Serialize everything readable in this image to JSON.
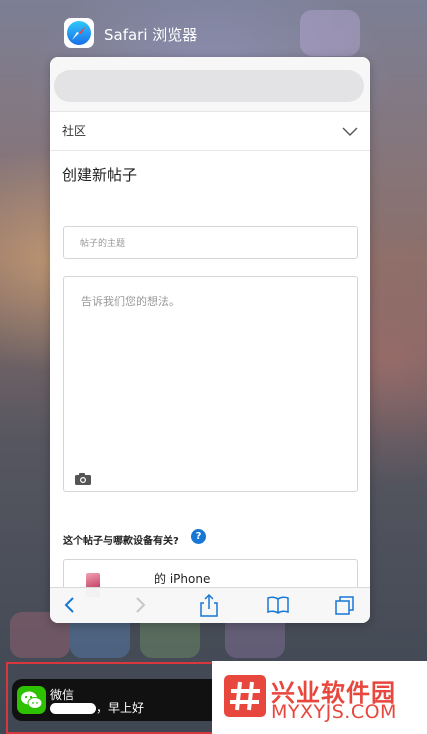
{
  "app_switcher": {
    "app_name": "Safari 浏览器",
    "app_icon": "safari-compass-icon"
  },
  "page": {
    "community_select": "社区",
    "heading": "创建新帖子",
    "subject_placeholder": "帖子的主题",
    "body_placeholder": "告诉我们您的想法。",
    "device_question": "这个帖子与哪款设备有关?",
    "help_icon_glyph": "?",
    "device_name": "的 iPhone"
  },
  "toolbar": {
    "icons": [
      "back-icon",
      "forward-icon",
      "share-icon",
      "bookmarks-icon",
      "tabs-icon"
    ],
    "accent": "#1777d6"
  },
  "notification": {
    "app": "微信",
    "message": "，早上好",
    "icon": "wechat-icon",
    "highlight_color": "#d9363e"
  },
  "watermark": {
    "text_cn": "兴业软件园",
    "text_en": "MYXYJS.COM",
    "color": "#e8473d"
  }
}
